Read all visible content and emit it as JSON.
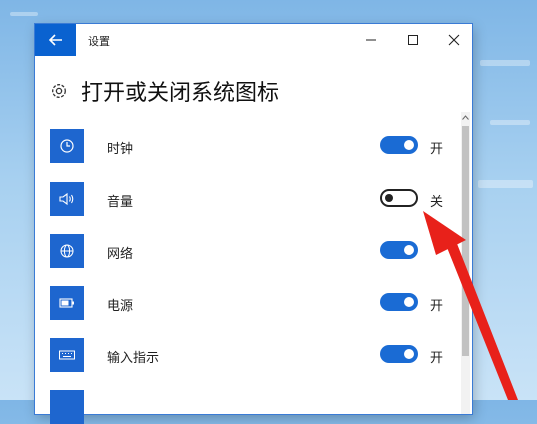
{
  "window": {
    "title": "设置"
  },
  "page": {
    "title": "打开或关闭系统图标",
    "icon": "gear-icon"
  },
  "items": [
    {
      "label": "时钟",
      "state": "开",
      "on": true,
      "icon": "clock-icon"
    },
    {
      "label": "音量",
      "state": "关",
      "on": false,
      "icon": "volume-icon"
    },
    {
      "label": "网络",
      "state": "",
      "on": true,
      "icon": "globe-icon"
    },
    {
      "label": "电源",
      "state": "开",
      "on": true,
      "icon": "battery-icon"
    },
    {
      "label": "输入指示",
      "state": "开",
      "on": true,
      "icon": "keyboard-icon"
    }
  ],
  "colors": {
    "accent": "#0a62d0",
    "toggle_on": "#1a6bd4",
    "annotation_arrow": "#e8211a"
  }
}
